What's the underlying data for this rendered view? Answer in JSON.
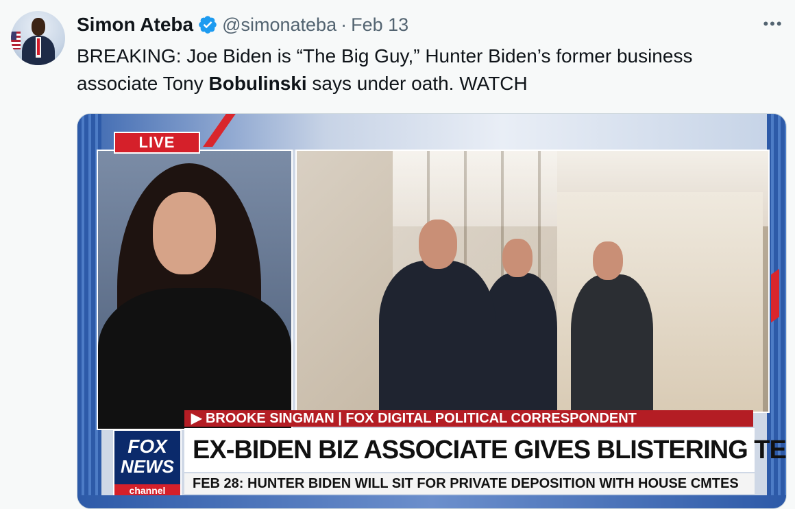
{
  "tweet": {
    "author_name": "Simon Ateba",
    "handle": "@simonateba",
    "separator": "·",
    "date": "Feb 13",
    "more_label": "•••",
    "text_before": "BREAKING: Joe Biden is “The Big Guy,” Hunter Biden’s former business associate Tony ",
    "text_bold": "Bobulinski",
    "text_after": " says under oath. WATCH"
  },
  "video": {
    "live_badge": "LIVE",
    "lower_name": "▶ BROOKE SINGMAN | FOX DIGITAL POLITICAL CORRESPONDENT",
    "headline": "EX-BIDEN BIZ ASSOCIATE GIVES BLISTERING TESTIMONY",
    "ticker": "FEB 28: HUNTER BIDEN WILL SIT FOR PRIVATE DEPOSITION WITH HOUSE CMTES",
    "logo": {
      "fox": "FOX",
      "news": "NEWS",
      "channel": "channel"
    }
  },
  "icons": {
    "verified": "verified-badge-icon",
    "more": "more-icon"
  },
  "colors": {
    "verified": "#1d9bf0",
    "fox_red": "#d5202a",
    "fox_blue": "#0b2a6b"
  }
}
